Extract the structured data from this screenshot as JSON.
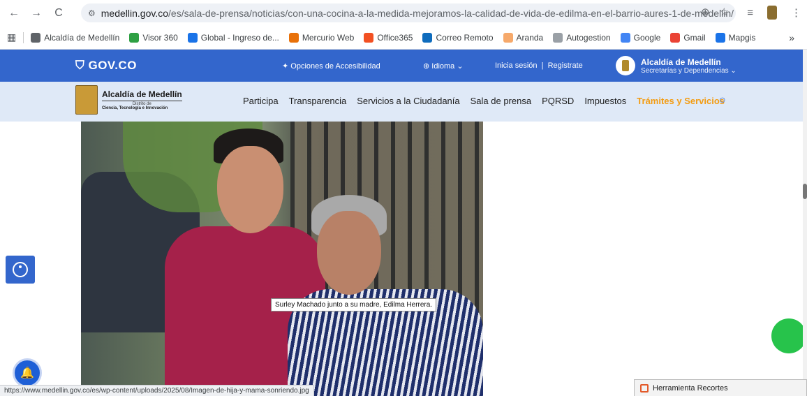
{
  "browser": {
    "url_prefix": "medellin.gov.co",
    "url_path": "/es/sala-de-prensa/noticias/con-una-cocina-a-la-medida-mejoramos-la-calidad-de-vida-de-edilma-en-el-barrio-aures-1-de-medellin/",
    "back_icon": "←",
    "forward_icon": "→",
    "reload_icon": "C",
    "site_info_icon": "⚙",
    "zoom_icon": "⊕",
    "star_icon": "☆",
    "menu_icon": "⋮",
    "reading_list_icon": "≡"
  },
  "bookmarks": {
    "apps_icon": "▦",
    "more_icon": "»",
    "items": [
      {
        "label": "Alcaldía de Medellín",
        "color": "#5f6368"
      },
      {
        "label": "Visor 360",
        "color": "#2ea043"
      },
      {
        "label": "Global - Ingreso de...",
        "color": "#1a73e8"
      },
      {
        "label": "Mercurio Web",
        "color": "#e8710a"
      },
      {
        "label": "Office365",
        "color": "#f25022"
      },
      {
        "label": "Correo Remoto",
        "color": "#0f6cbd"
      },
      {
        "label": "Aranda",
        "color": "#f6a96b"
      },
      {
        "label": "Autogestion",
        "color": "#9aa0a6"
      },
      {
        "label": "Google",
        "color": "#4285f4"
      },
      {
        "label": "Gmail",
        "color": "#ea4335"
      },
      {
        "label": "Mapgis",
        "color": "#1a73e8"
      }
    ]
  },
  "govbar": {
    "logo": "GOV.CO",
    "accessibility": "Opciones de Accesibilidad",
    "language": "Idioma",
    "login": "Inicia sesión  |  Registrate",
    "alcaldia_title": "Alcaldía de Medellín",
    "alcaldia_sub": "Secretarías y Dependencias"
  },
  "site": {
    "logo_title": "Alcaldía de Medellín",
    "logo_district": "Distrito de",
    "logo_sub": "Ciencia, Tecnología e Innovación",
    "nav": [
      "Participa",
      "Transparencia",
      "Servicios a la Ciudadanía",
      "Sala de prensa",
      "PQRSD",
      "Impuestos"
    ],
    "nav_active": "Trámites y Servicios",
    "search_icon": "○"
  },
  "content": {
    "caption": "Surley Machado junto a su madre, Edilma Herrera."
  },
  "statusbar": {
    "link": "https://www.medellin.gov.co/es/wp-content/uploads/2025/08/Imagen-de-hija-y-mama-sonriendo.jpg"
  },
  "snipping_tool": {
    "label": "Herramienta Recortes"
  },
  "colors": {
    "gov_blue": "#3366cc",
    "header_bg": "#dfe9f7",
    "active_nav": "#f39c12",
    "whatsapp_green": "#27c34b"
  }
}
